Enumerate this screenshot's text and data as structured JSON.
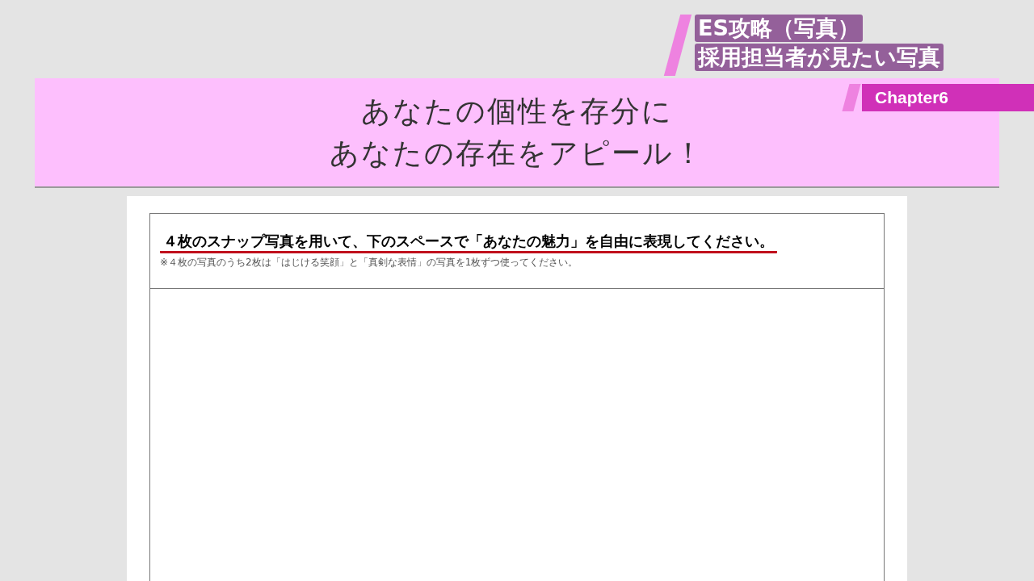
{
  "overlay": {
    "title_line_1": "ES攻略（写真）",
    "title_line_2": "採用担当者が見たい写真",
    "chapter": "Chapter6"
  },
  "banner": {
    "lines": [
      "あなたの個性を存分に",
      "あなたの存在をアピール！"
    ]
  },
  "document": {
    "instruction": "４枚のスナップ写真を用いて、下のスペースで「あなたの魅力」を自由に表現してください。",
    "note": "※４枚の写真のうち2枚は「はじける笑顔」と「真剣な表情」の写真を1枚ずつ使ってください。"
  }
}
